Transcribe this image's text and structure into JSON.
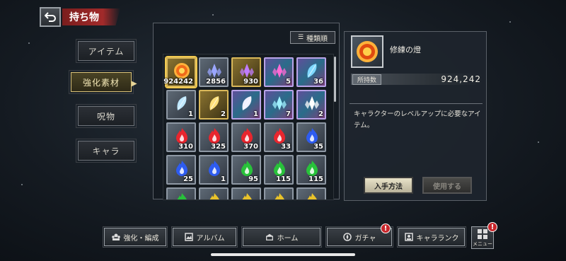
{
  "header": {
    "title": "持ち物"
  },
  "categories": [
    {
      "label": "アイテム",
      "active": false
    },
    {
      "label": "強化素材",
      "active": true
    },
    {
      "label": "呪物",
      "active": false
    },
    {
      "label": "キャラ",
      "active": false
    }
  ],
  "sort": {
    "label": "種類順"
  },
  "grid": {
    "rows": [
      [
        {
          "count": "924242",
          "frame": "gold",
          "icon": "fire-orb-icon",
          "color": "#f06a1a",
          "selected": true
        },
        {
          "count": "2856",
          "frame": "silver",
          "icon": "crystal-cluster-icon",
          "color": "#9aa6ff",
          "selected": false
        },
        {
          "count": "930",
          "frame": "gold",
          "icon": "crystal-cluster-icon",
          "color": "#c07cff",
          "selected": false
        },
        {
          "count": "5",
          "frame": "rainbow",
          "icon": "crystal-cluster-icon",
          "color": "#ff6ad5",
          "selected": false
        },
        {
          "count": "36",
          "frame": "rainbow",
          "icon": "feather-icon",
          "color": "#7fd8ff",
          "selected": false
        }
      ],
      [
        {
          "count": "1",
          "frame": "silver",
          "icon": "feather-icon",
          "color": "#bfe8ff",
          "selected": false
        },
        {
          "count": "2",
          "frame": "gold",
          "icon": "feather-icon",
          "color": "#ffe07a",
          "selected": false
        },
        {
          "count": "1",
          "frame": "rainbow",
          "icon": "feather-icon",
          "color": "#f0f0ff",
          "selected": false
        },
        {
          "count": "7",
          "frame": "rainbow",
          "icon": "crystal-cluster-icon",
          "color": "#9ff0ff",
          "selected": false
        },
        {
          "count": "2",
          "frame": "rainbow",
          "icon": "crystal-cluster-icon",
          "color": "#ffffff",
          "selected": false
        }
      ],
      [
        {
          "count": "310",
          "frame": "silver",
          "icon": "red-flame-icon",
          "color": "#e8262e",
          "selected": false
        },
        {
          "count": "325",
          "frame": "silver",
          "icon": "red-flame-icon",
          "color": "#e8262e",
          "selected": false
        },
        {
          "count": "370",
          "frame": "silver",
          "icon": "red-flame-icon",
          "color": "#e8262e",
          "selected": false
        },
        {
          "count": "33",
          "frame": "silver",
          "icon": "red-flame-icon",
          "color": "#e8262e",
          "selected": false
        },
        {
          "count": "35",
          "frame": "silver",
          "icon": "blue-flame-icon",
          "color": "#2e5cf0",
          "selected": false
        }
      ],
      [
        {
          "count": "25",
          "frame": "silver",
          "icon": "blue-flame-icon",
          "color": "#2e5cf0",
          "selected": false
        },
        {
          "count": "1",
          "frame": "silver",
          "icon": "blue-flame-icon",
          "color": "#2e5cf0",
          "selected": false
        },
        {
          "count": "95",
          "frame": "silver",
          "icon": "green-flame-icon",
          "color": "#28c23a",
          "selected": false
        },
        {
          "count": "115",
          "frame": "silver",
          "icon": "green-flame-icon",
          "color": "#28c23a",
          "selected": false
        },
        {
          "count": "115",
          "frame": "silver",
          "icon": "green-flame-icon",
          "color": "#28c23a",
          "selected": false
        }
      ],
      [
        {
          "count": "",
          "frame": "silver",
          "icon": "green-flame-icon",
          "color": "#28c23a",
          "selected": false
        },
        {
          "count": "",
          "frame": "silver",
          "icon": "yellow-flame-icon",
          "color": "#e8c22a",
          "selected": false
        },
        {
          "count": "",
          "frame": "silver",
          "icon": "yellow-flame-icon",
          "color": "#e8c22a",
          "selected": false
        },
        {
          "count": "",
          "frame": "silver",
          "icon": "yellow-flame-icon",
          "color": "#e8c22a",
          "selected": false
        },
        {
          "count": "",
          "frame": "silver",
          "icon": "yellow-flame-icon",
          "color": "#e8c22a",
          "selected": false
        }
      ]
    ]
  },
  "detail": {
    "name": "修練の燈",
    "owned_label": "所持数",
    "owned_value": "924,242",
    "description": "キャラクターのレベルアップに必要なアイテム。",
    "obtain_label": "入手方法",
    "use_label": "使用する"
  },
  "nav": {
    "enhance_label": "強化・編成",
    "album_label": "アルバム",
    "home_label": "ホーム",
    "gacha_label": "ガチャ",
    "rank_label": "キャラランク",
    "menu_label": "メニュー",
    "alert_mark": "!"
  },
  "colors": {
    "alert": "#c7262b",
    "accent_gold": "#d8c077",
    "title_red": "#a22a2a"
  }
}
